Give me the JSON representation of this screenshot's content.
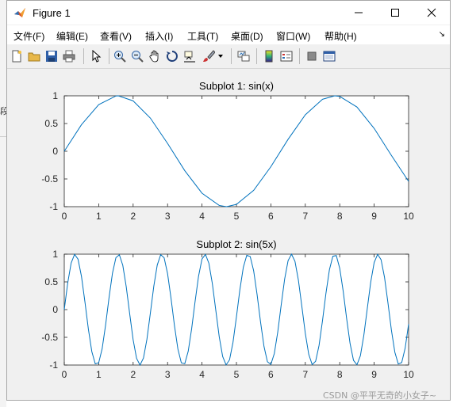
{
  "window": {
    "title": "Figure 1",
    "controls": [
      "minimize",
      "maximize",
      "close"
    ]
  },
  "menu": {
    "items": [
      "文件(F)",
      "编辑(E)",
      "查看(V)",
      "插入(I)",
      "工具(T)",
      "桌面(D)",
      "窗口(W)",
      "帮助(H)"
    ],
    "overflow": "↘"
  },
  "toolbar": {
    "icons": [
      "new-figure-icon",
      "open-file-icon",
      "save-icon",
      "print-icon",
      "select-arrow-icon",
      "zoom-in-icon",
      "zoom-out-icon",
      "pan-hand-icon",
      "rotate-3d-icon",
      "data-cursor-icon",
      "brush-icon",
      "link-plot-icon",
      "colorbar-icon",
      "legend-icon",
      "hide-plot-tools-icon",
      "show-plot-tools-icon"
    ]
  },
  "background": {
    "left_fragment": "段"
  },
  "watermark": "CSDN @平平无奇的小女子~",
  "chart_data": [
    {
      "type": "line",
      "title": "Subplot 1: sin(x)",
      "function": "sin(x)",
      "xlim": [
        0,
        10
      ],
      "ylim": [
        -1,
        1
      ],
      "xticks": [
        "0",
        "1",
        "2",
        "3",
        "4",
        "5",
        "6",
        "7",
        "8",
        "9",
        "10"
      ],
      "yticks": [
        "1",
        "0.5",
        "0",
        "-0.5",
        "-1"
      ],
      "color": "#0072BD",
      "series": [
        {
          "x": [
            0,
            0.5,
            1,
            1.5,
            1.5708,
            2,
            2.5,
            3,
            3.5,
            4,
            4.5,
            4.7124,
            5,
            5.5,
            6,
            6.5,
            7,
            7.5,
            7.854,
            8,
            8.5,
            9,
            9.5,
            10
          ],
          "y": [
            0,
            0.479,
            0.841,
            0.997,
            1,
            0.909,
            0.598,
            0.141,
            -0.351,
            -0.757,
            -0.978,
            -1,
            -0.959,
            -0.706,
            -0.279,
            0.215,
            0.657,
            0.938,
            1,
            0.989,
            0.798,
            0.412,
            -0.075,
            -0.544
          ]
        }
      ]
    },
    {
      "type": "line",
      "title": "Subplot 2: sin(5x)",
      "function": "sin(5x)",
      "xlim": [
        0,
        10
      ],
      "ylim": [
        -1,
        1
      ],
      "xticks": [
        "0",
        "1",
        "2",
        "3",
        "4",
        "5",
        "6",
        "7",
        "8",
        "9",
        "10"
      ],
      "yticks": [
        "1",
        "0.5",
        "0",
        "-0.5",
        "-1"
      ],
      "color": "#0072BD",
      "series": [
        {
          "x": [
            0,
            0.1,
            0.2,
            0.3,
            0.4,
            0.5,
            0.6,
            0.7,
            0.8,
            0.9,
            1,
            1.1,
            1.2,
            1.3,
            1.4,
            1.5,
            1.6,
            1.7,
            1.8,
            1.9,
            2,
            2.1,
            2.2,
            2.3,
            2.4,
            2.5,
            2.6,
            2.7,
            2.8,
            2.9,
            3,
            3.1,
            3.2,
            3.3,
            3.4,
            3.5,
            3.6,
            3.7,
            3.8,
            3.9,
            4,
            4.1,
            4.2,
            4.3,
            4.4,
            4.5,
            4.6,
            4.7,
            4.8,
            4.9,
            5,
            5.1,
            5.2,
            5.3,
            5.4,
            5.5,
            5.6,
            5.7,
            5.8,
            5.9,
            6,
            6.1,
            6.2,
            6.3,
            6.4,
            6.5,
            6.6,
            6.7,
            6.8,
            6.9,
            7,
            7.1,
            7.2,
            7.3,
            7.4,
            7.5,
            7.6,
            7.7,
            7.8,
            7.9,
            8,
            8.1,
            8.2,
            8.3,
            8.4,
            8.5,
            8.6,
            8.7,
            8.8,
            8.9,
            9,
            9.1,
            9.2,
            9.3,
            9.4,
            9.5,
            9.6,
            9.7,
            9.8,
            9.9,
            10
          ],
          "y": [
            0,
            0.479,
            0.841,
            0.997,
            0.909,
            0.598,
            0.141,
            -0.351,
            -0.757,
            -0.978,
            -0.959,
            -0.706,
            -0.279,
            0.215,
            0.657,
            0.938,
            0.989,
            0.798,
            0.412,
            -0.075,
            -0.544,
            -0.88,
            -1.0,
            -0.875,
            -0.537,
            -0.066,
            0.42,
            0.803,
            0.991,
            0.935,
            0.65,
            0.206,
            -0.288,
            -0.712,
            -0.961,
            -0.976,
            -0.751,
            -0.342,
            0.15,
            0.604,
            0.913,
            0.996,
            0.836,
            0.471,
            -0.009,
            -0.488,
            -0.846,
            -0.998,
            -0.905,
            -0.591,
            -0.132,
            0.359,
            0.763,
            0.98,
            0.957,
            0.701,
            0.27,
            -0.223,
            -0.663,
            -0.941,
            -0.988,
            -0.793,
            -0.404,
            0.084,
            0.551,
            0.884,
            1.0,
            0.871,
            0.53,
            0.057,
            -0.428,
            -0.808,
            -0.992,
            -0.932,
            -0.644,
            -0.197,
            0.296,
            0.718,
            0.963,
            0.975,
            0.745,
            0.334,
            -0.159,
            -0.611,
            -0.916,
            -0.995,
            -0.832,
            -0.463,
            0.018,
            0.496,
            0.85,
            0.998,
            0.901,
            0.584,
            0.123,
            -0.367,
            -0.768,
            -0.981,
            -0.955,
            -0.695,
            -0.262
          ]
        }
      ]
    }
  ]
}
